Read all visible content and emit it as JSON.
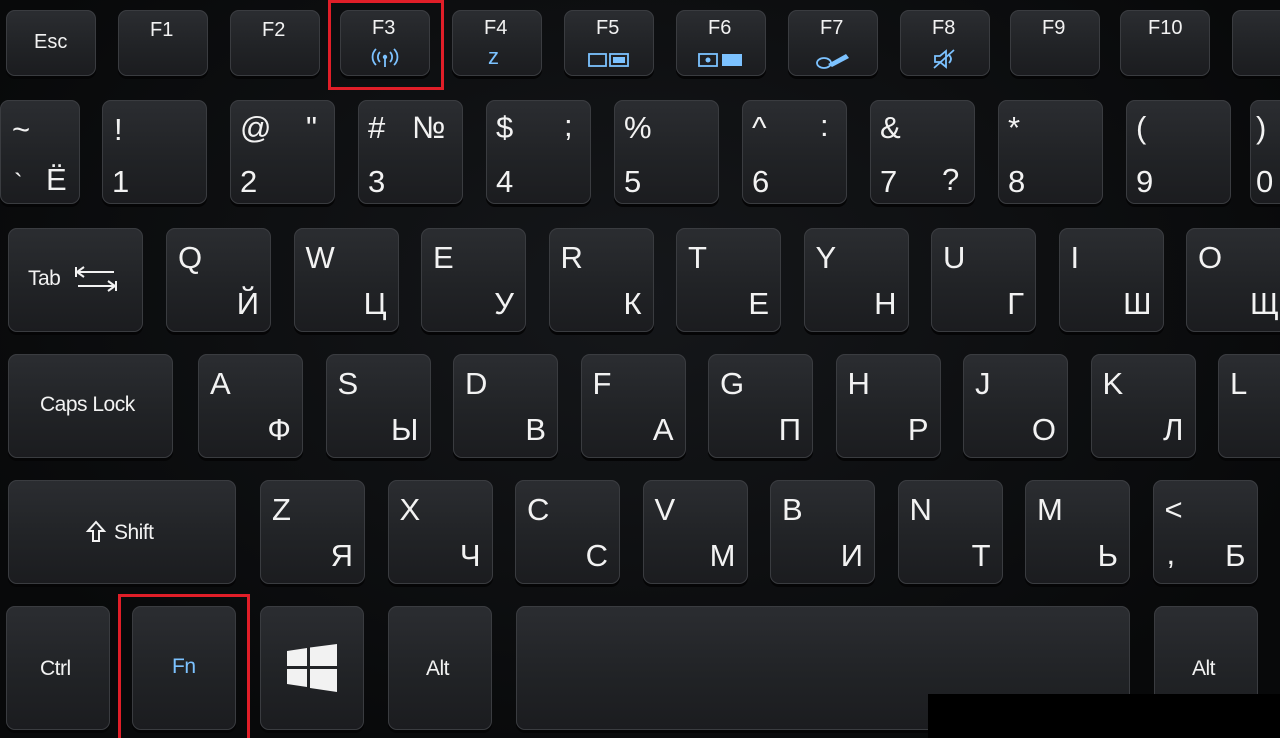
{
  "function_row": {
    "esc": "Esc",
    "f1": "F1",
    "f2": "F2",
    "f3": "F3",
    "f4": "F4",
    "f5": "F5",
    "f6": "F6",
    "f7": "F7",
    "f8": "F8",
    "f9": "F9",
    "f10": "F10",
    "f3_icon": "wireless-icon",
    "f4_icon": "sleep-icon",
    "f5_icon": "display-switch-icon",
    "f6_icon": "screen-off-icon",
    "f7_icon": "touchpad-toggle-icon",
    "f8_icon": "speaker-mute-icon",
    "f4_sub": "z"
  },
  "number_row": [
    {
      "top_left": "~",
      "top_right": "",
      "bottom_left": "`",
      "bottom_right": "Ё"
    },
    {
      "top_left": "!",
      "top_right": "",
      "bottom_left": "1",
      "bottom_right": ""
    },
    {
      "top_left": "@",
      "top_right": "\"",
      "bottom_left": "2",
      "bottom_right": ""
    },
    {
      "top_left": "#",
      "top_right": "№",
      "bottom_left": "3",
      "bottom_right": ""
    },
    {
      "top_left": "$",
      "top_right": ";",
      "bottom_left": "4",
      "bottom_right": ""
    },
    {
      "top_left": "%",
      "top_right": "",
      "bottom_left": "5",
      "bottom_right": ""
    },
    {
      "top_left": "^",
      "top_right": ":",
      "bottom_left": "6",
      "bottom_right": ""
    },
    {
      "top_left": "&",
      "top_right": "",
      "bottom_left": "7",
      "bottom_right": "?"
    },
    {
      "top_left": "*",
      "top_right": "",
      "bottom_left": "8",
      "bottom_right": ""
    },
    {
      "top_left": "(",
      "top_right": "",
      "bottom_left": "9",
      "bottom_right": ""
    },
    {
      "top_left": ")",
      "top_right": "",
      "bottom_left": "0",
      "bottom_right": ""
    }
  ],
  "qwerty_row": [
    {
      "latin": "Q",
      "cyr": "Й"
    },
    {
      "latin": "W",
      "cyr": "Ц"
    },
    {
      "latin": "E",
      "cyr": "У"
    },
    {
      "latin": "R",
      "cyr": "К"
    },
    {
      "latin": "T",
      "cyr": "Е"
    },
    {
      "latin": "Y",
      "cyr": "Н"
    },
    {
      "latin": "U",
      "cyr": "Г"
    },
    {
      "latin": "I",
      "cyr": "Ш"
    },
    {
      "latin": "O",
      "cyr": "Щ"
    }
  ],
  "home_row": [
    {
      "latin": "A",
      "cyr": "Ф"
    },
    {
      "latin": "S",
      "cyr": "Ы"
    },
    {
      "latin": "D",
      "cyr": "В"
    },
    {
      "latin": "F",
      "cyr": "А"
    },
    {
      "latin": "G",
      "cyr": "П"
    },
    {
      "latin": "H",
      "cyr": "Р"
    },
    {
      "latin": "J",
      "cyr": "О"
    },
    {
      "latin": "K",
      "cyr": "Л"
    },
    {
      "latin": "L",
      "cyr": ""
    }
  ],
  "bottom_row": [
    {
      "latin": "Z",
      "cyr": "Я"
    },
    {
      "latin": "X",
      "cyr": "Ч"
    },
    {
      "latin": "C",
      "cyr": "С"
    },
    {
      "latin": "V",
      "cyr": "М"
    },
    {
      "latin": "B",
      "cyr": "И"
    },
    {
      "latin": "N",
      "cyr": "Т"
    },
    {
      "latin": "M",
      "cyr": "Ь"
    },
    {
      "latin": "<",
      "cyr": "Б",
      "extra": ","
    }
  ],
  "modifiers": {
    "tab": "Tab",
    "caps_lock": "Caps Lock",
    "shift": "Shift",
    "ctrl": "Ctrl",
    "fn": "Fn",
    "alt_left": "Alt",
    "alt_right": "Alt",
    "windows_icon": "windows-logo-icon",
    "shift_icon": "shift-arrow-icon",
    "tab_icon": "tab-arrows-icon"
  },
  "colors": {
    "highlight": "#e01e28",
    "fn_blue": "#7cc2ff",
    "key_face": "#24262a",
    "legend": "#f2f2f2"
  },
  "highlighted_keys": [
    "F3",
    "Fn"
  ]
}
